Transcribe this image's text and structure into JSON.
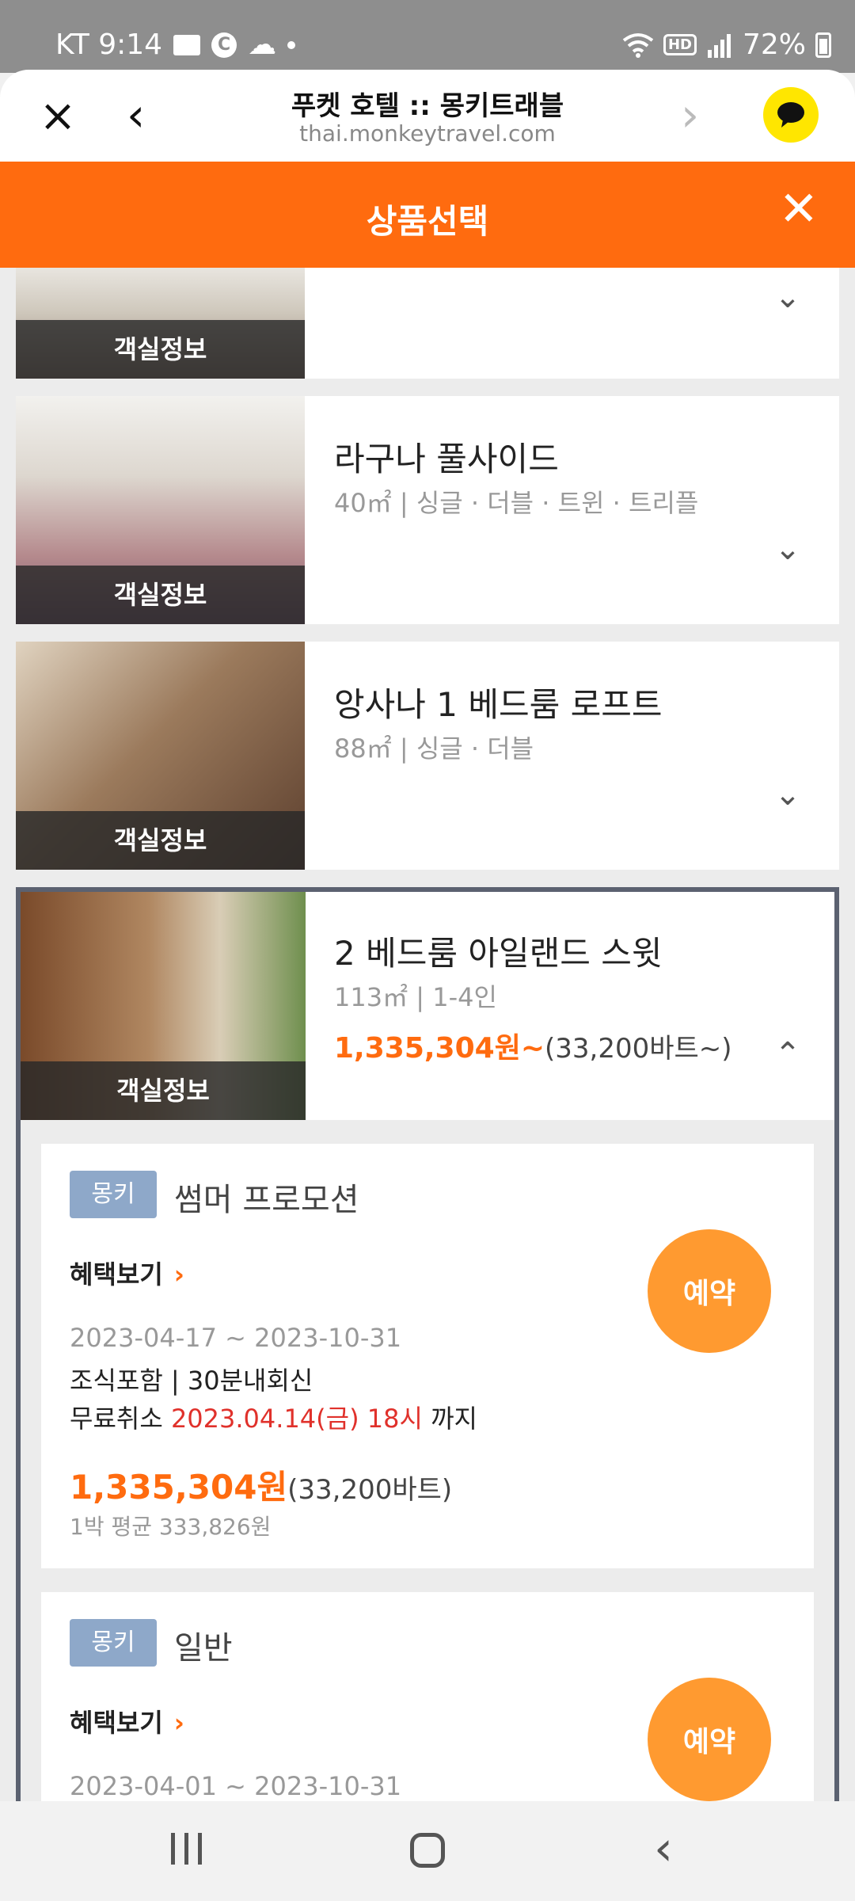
{
  "status_bar": {
    "carrier_time": "KT 9:14",
    "icons": [
      "gallery-icon",
      "c-icon",
      "cloud-icon",
      "dot-icon",
      "wifi-icon",
      "hd-icon",
      "signal-icon",
      "battery-icon"
    ],
    "hd": "HD",
    "battery": "72%"
  },
  "browser": {
    "title": "푸켓 호텔 :: 몽키트래블",
    "url": "thai.monkeytravel.com"
  },
  "header": {
    "title": "상품선택"
  },
  "rooms": [
    {
      "name": "",
      "spec": "",
      "label": "객실정보"
    },
    {
      "name": "라구나 풀사이드",
      "spec": "40㎡ | 싱글 · 더블 · 트윈 · 트리플",
      "label": "객실정보"
    },
    {
      "name": "앙사나 1 베드룸 로프트",
      "spec": "88㎡ | 싱글 · 더블",
      "label": "객실정보"
    },
    {
      "name": "2 베드룸 아일랜드 스윗",
      "spec": "113㎡ | 1-4인",
      "label": "객실정보",
      "price": "1,335,304원~",
      "price_sub": "(33,200바트~)"
    }
  ],
  "offers": [
    {
      "tag": "몽키",
      "name": "썸머 프로모션",
      "benefit": "혜택보기",
      "reserve": "예약",
      "dates": "2023-04-17 ~ 2023-10-31",
      "conditions": "조식포함 | 30분내회신",
      "cancel_prefix": "무료취소 ",
      "cancel_date": "2023.04.14(금) 18시",
      "cancel_suffix": " 까지",
      "price": "1,335,304원",
      "price_sub": "(33,200바트)",
      "avg": "1박 평균 333,826원"
    },
    {
      "tag": "몽키",
      "name": "일반",
      "benefit": "혜택보기",
      "reserve": "예약",
      "dates": "2023-04-01 ~ 2023-10-31"
    }
  ],
  "colors": {
    "accent": "#ff6b0f",
    "reserve": "#ff9a30",
    "tag": "#8ea8c9",
    "cancel_red": "#e0312b",
    "kakao": "#ffe600"
  }
}
